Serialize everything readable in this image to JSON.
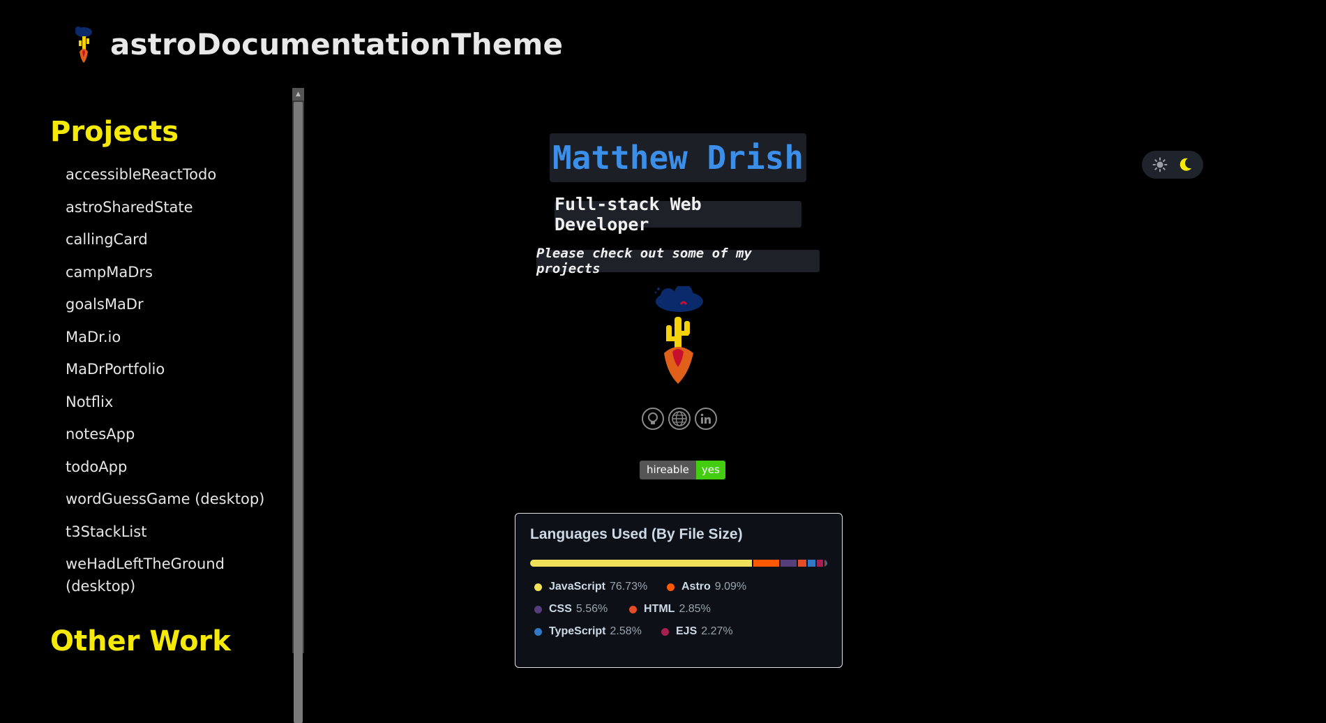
{
  "header": {
    "title": "astroDocumentationTheme",
    "logo_icon": "cactus-rocket-logo"
  },
  "sidebar": {
    "sections": [
      {
        "heading": "Projects",
        "items": [
          {
            "label": "accessibleReactTodo"
          },
          {
            "label": "astroSharedState"
          },
          {
            "label": "callingCard"
          },
          {
            "label": "campMaDrs"
          },
          {
            "label": "goalsMaDr"
          },
          {
            "label": "MaDr.io"
          },
          {
            "label": "MaDrPortfolio"
          },
          {
            "label": "Notflix"
          },
          {
            "label": "notesApp"
          },
          {
            "label": "todoApp"
          },
          {
            "label": "wordGuessGame (desktop)"
          },
          {
            "label": "t3StackList"
          },
          {
            "label": "weHadLeftTheGround (desktop)"
          }
        ]
      },
      {
        "heading": "Other Work"
      }
    ]
  },
  "profile": {
    "name": "Matthew Drish",
    "role": "Full-stack Web Developer",
    "cta": "Please check out some of my projects",
    "avatar_icon": "cactus-rocket-avatar",
    "socials": [
      {
        "name": "github-icon"
      },
      {
        "name": "globe-icon"
      },
      {
        "name": "linkedin-icon"
      }
    ],
    "badge": {
      "label": "hireable",
      "value": "yes"
    }
  },
  "theme_toggle": {
    "light_icon": "sun-icon",
    "dark_icon": "moon-icon",
    "active": "dark"
  },
  "languages_card": {
    "title": "Languages Used (By File Size)",
    "languages": [
      {
        "name": "JavaScript",
        "percent": "76.73%",
        "color": "#f1e05a",
        "value": 76.73
      },
      {
        "name": "Astro",
        "percent": "9.09%",
        "color": "#ff5a03",
        "value": 9.09
      },
      {
        "name": "CSS",
        "percent": "5.56%",
        "color": "#563d7c",
        "value": 5.56
      },
      {
        "name": "HTML",
        "percent": "2.85%",
        "color": "#e34c26",
        "value": 2.85
      },
      {
        "name": "TypeScript",
        "percent": "2.58%",
        "color": "#3178c6",
        "value": 2.58
      },
      {
        "name": "EJS",
        "percent": "2.27%",
        "color": "#a91e50",
        "value": 2.27
      }
    ]
  },
  "colors": {
    "accent_yellow": "#f5e90a",
    "name_blue": "#3b8fe8",
    "badge_green": "#44cc11"
  }
}
